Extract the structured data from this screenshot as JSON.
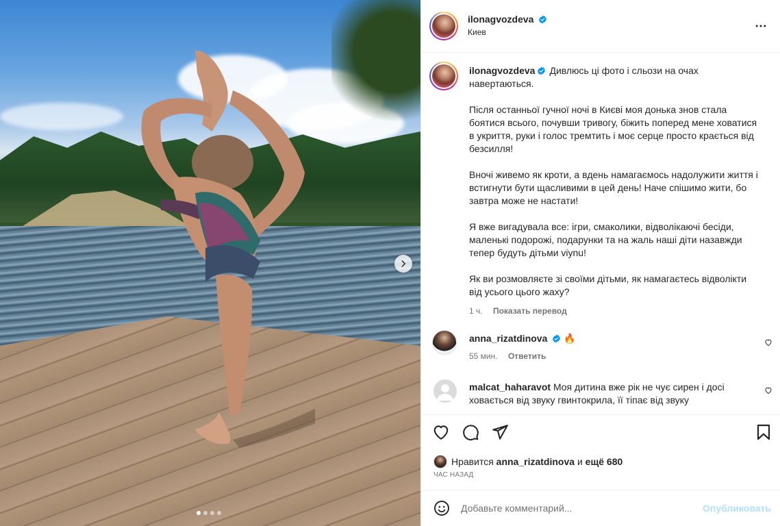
{
  "post": {
    "author": "ilonagvozdeva",
    "location": "Киев",
    "caption_paragraphs": [
      "Дивлюсь ці фото і сльози на очах навертаються.",
      "Після останньої гучної ночі в Києві моя донька знов стала боятися всього, почувши тривогу, біжить поперед мене ховатися в укриття, руки і голос тремтить і моє серце просто крається від безсилля!",
      "Вночі живемо як кроти, а вдень намагаємось надолужити життя і встигнути бути щасливими в цей день! Наче спішимо жити, бо завтра може не настати!",
      "Я вже вигадувала все: ігри, смаколики, відволікаючі бесіди, маленькі подорожі, подарунки та на жаль наші діти назавжди тепер будуть дітьми viynu!",
      "Як ви розмовляєте зі своїми дітьми, як намагаєтесь відволікти від усього цього жаху?"
    ],
    "caption_time": "1 ч.",
    "show_translation": "Показать перевод",
    "carousel_active_index": 1,
    "carousel_total": 4
  },
  "comments": [
    {
      "user": "anna_rizatdinova",
      "verified": true,
      "text": "🔥",
      "time": "55 мин.",
      "reply": "Ответить"
    },
    {
      "user": "malcat_haharavot",
      "verified": false,
      "text": "Моя дитина вже рік не чує сирен і досі ховається від звуку гвинтокрила, її тіпає від звуку",
      "time": "",
      "reply": ""
    }
  ],
  "likes": {
    "prefix": "Нравится",
    "user": "anna_rizatdinova",
    "conjunction": "и",
    "others": "ещё 680"
  },
  "time_ago": "ЧАС НАЗАД",
  "add_comment": {
    "placeholder": "Добавьте комментарий...",
    "publish_label": "Опубликовать"
  },
  "colors": {
    "verified_blue": "#0095f6",
    "publish_disabled": "#b2dffc",
    "muted_text": "#737373"
  },
  "icons": [
    "more-icon",
    "heart-icon",
    "comment-icon",
    "share-icon",
    "bookmark-icon",
    "emoji-icon",
    "chevron-right-icon",
    "verified-icon",
    "fire-emoji"
  ]
}
